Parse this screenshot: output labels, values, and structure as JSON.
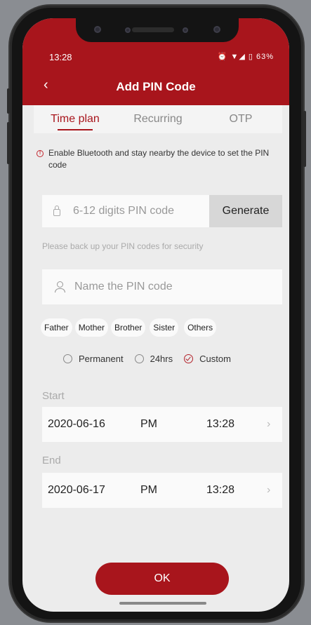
{
  "status": {
    "time": "13:28",
    "battery": "63%",
    "icons": "⏰ ▼◢ ▯"
  },
  "header": {
    "back_icon": "‹",
    "title": "Add PIN Code"
  },
  "tabs": [
    {
      "label": "Time plan",
      "active": true
    },
    {
      "label": "Recurring",
      "active": false
    },
    {
      "label": "OTP",
      "active": false
    }
  ],
  "notice": {
    "text": "Enable Bluetooth and stay nearby the device to set the PIN code"
  },
  "pin": {
    "placeholder": "6-12 digits PIN code",
    "generate_label": "Generate"
  },
  "backup_text": "Please back up your PIN codes for security",
  "name": {
    "placeholder": "Name the PIN code"
  },
  "chips": [
    "Father",
    "Mother",
    "Brother",
    "Sister",
    "Others"
  ],
  "duration": {
    "options": [
      "Permanent",
      "24hrs",
      "Custom"
    ],
    "selected": "Custom"
  },
  "start": {
    "label": "Start",
    "date": "2020-06-16",
    "ampm": "PM",
    "time": "13:28"
  },
  "end": {
    "label": "End",
    "date": "2020-06-17",
    "ampm": "PM",
    "time": "13:28"
  },
  "ok_label": "OK",
  "colors": {
    "accent": "#a8151c",
    "background": "#ececec"
  }
}
